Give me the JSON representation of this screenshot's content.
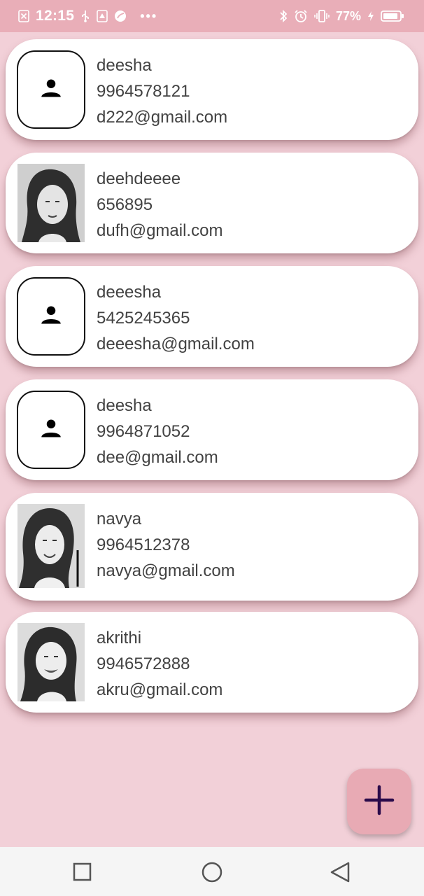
{
  "status_bar": {
    "time": "12:15",
    "battery_percent": "77%"
  },
  "contacts": [
    {
      "name": "deesha",
      "phone": "9964578121",
      "email": "d222@gmail.com",
      "avatar": "person-icon"
    },
    {
      "name": "deehdeeee",
      "phone": "656895",
      "email": "dufh@gmail.com",
      "avatar": "photo"
    },
    {
      "name": "deeesha",
      "phone": "5425245365",
      "email": "deeesha@gmail.com",
      "avatar": "person-icon"
    },
    {
      "name": "deesha",
      "phone": "9964871052",
      "email": "dee@gmail.com",
      "avatar": "person-icon"
    },
    {
      "name": "navya",
      "phone": "9964512378",
      "email": "navya@gmail.com",
      "avatar": "photo"
    },
    {
      "name": "akrithi",
      "phone": "9946572888",
      "email": "akru@gmail.com",
      "avatar": "photo"
    }
  ],
  "fab": {
    "icon": "plus-icon"
  },
  "nav": {
    "recents_icon": "square-icon",
    "home_icon": "circle-icon",
    "back_icon": "triangle-back-icon"
  },
  "colors": {
    "accent": "#e8aab4",
    "background": "#f2d0d8",
    "status_bar": "#e9aeb8",
    "fab_icon": "#2a0a4a"
  }
}
